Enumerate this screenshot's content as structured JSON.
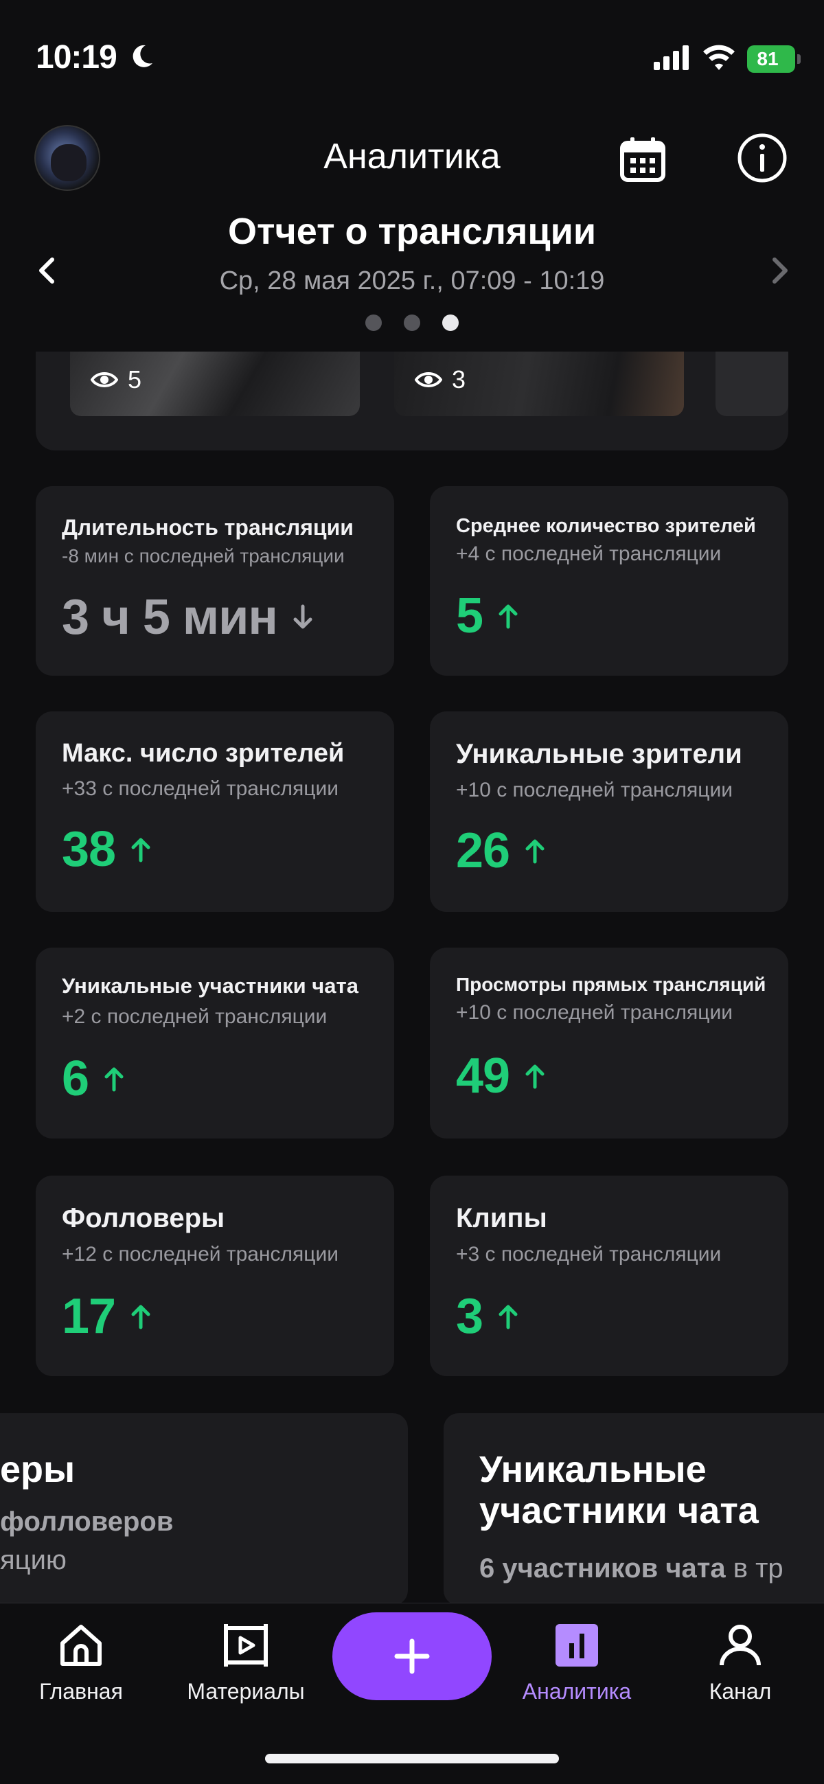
{
  "status_bar": {
    "time": "10:19",
    "battery": "81"
  },
  "header": {
    "title": "Аналитика"
  },
  "report": {
    "title": "Отчет о трансляции",
    "date": "Ср, 28 мая 2025 г., 07:09 - 10:19",
    "pages": 3,
    "active_page": 3
  },
  "clips": [
    {
      "views": "5"
    },
    {
      "views": "3"
    }
  ],
  "stats": [
    {
      "title": "Длительность трансляции",
      "sub": "-8 мин с последней трансляции",
      "value": "3 ч 5 мин",
      "trend": "down"
    },
    {
      "title": "Среднее количество зрителей",
      "sub": "+4 с последней трансляции",
      "value": "5",
      "trend": "up"
    },
    {
      "title": "Макс. число зрителей",
      "sub": "+33 с последней трансляции",
      "value": "38",
      "trend": "up"
    },
    {
      "title": "Уникальные зрители",
      "sub": "+10 с последней трансляции",
      "value": "26",
      "trend": "up"
    },
    {
      "title": "Уникальные участники чата",
      "sub": "+2 с последней трансляции",
      "value": "6",
      "trend": "up"
    },
    {
      "title": "Просмотры прямых трансляций",
      "sub": "+10 с последней трансляции",
      "value": "49",
      "trend": "up"
    },
    {
      "title": "Фолловеры",
      "sub": "+12 с последней трансляции",
      "value": "17",
      "trend": "up"
    },
    {
      "title": "Клипы",
      "sub": "+3 с последней трансляции",
      "value": "3",
      "trend": "up"
    }
  ],
  "bottom_cards": [
    {
      "title": "еры",
      "sub": "фолловеров",
      "sub2": "яцию"
    },
    {
      "title_line1": "Уникальные",
      "title_line2": "участники чата",
      "sub_bold": "6 участников чата",
      "sub_rest": " в тр"
    }
  ],
  "tabs": [
    {
      "label": "Главная",
      "icon": "home-icon"
    },
    {
      "label": "Материалы",
      "icon": "video-icon"
    },
    {
      "label": "Аналитика",
      "icon": "analytics-icon",
      "active": true
    },
    {
      "label": "Канал",
      "icon": "person-icon"
    }
  ],
  "colors": {
    "accent": "#9147ff",
    "up": "#1fce78",
    "active_tab": "#b58cff"
  }
}
